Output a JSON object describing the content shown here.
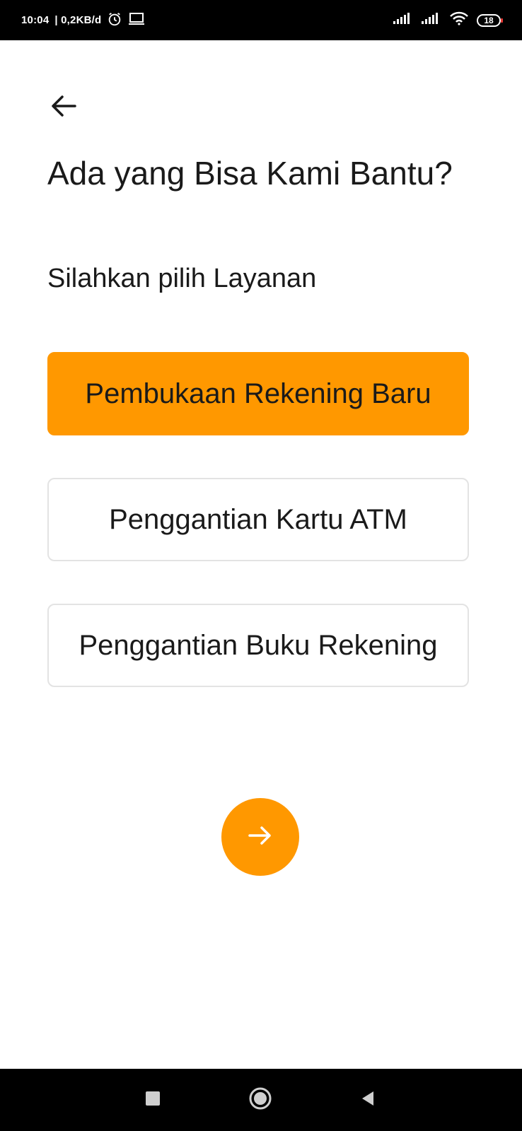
{
  "status_bar": {
    "time": "10:04",
    "net_speed": "| 0,2KB/d",
    "battery": "18"
  },
  "header": {
    "title": "Ada yang Bisa Kami Bantu?",
    "subtitle": "Silahkan pilih Layanan"
  },
  "options": [
    {
      "label": "Pembukaan Rekening Baru",
      "selected": true
    },
    {
      "label": "Penggantian Kartu ATM",
      "selected": false
    },
    {
      "label": "Penggantian Buku Rekening",
      "selected": false
    }
  ],
  "colors": {
    "accent": "#ff9800",
    "text": "#1a1a1a",
    "border": "#e3e3e3"
  },
  "icons": {
    "back": "arrow-left-icon",
    "next": "arrow-right-icon",
    "nav_recents": "square-icon",
    "nav_home": "circle-icon",
    "nav_back": "triangle-back-icon"
  }
}
